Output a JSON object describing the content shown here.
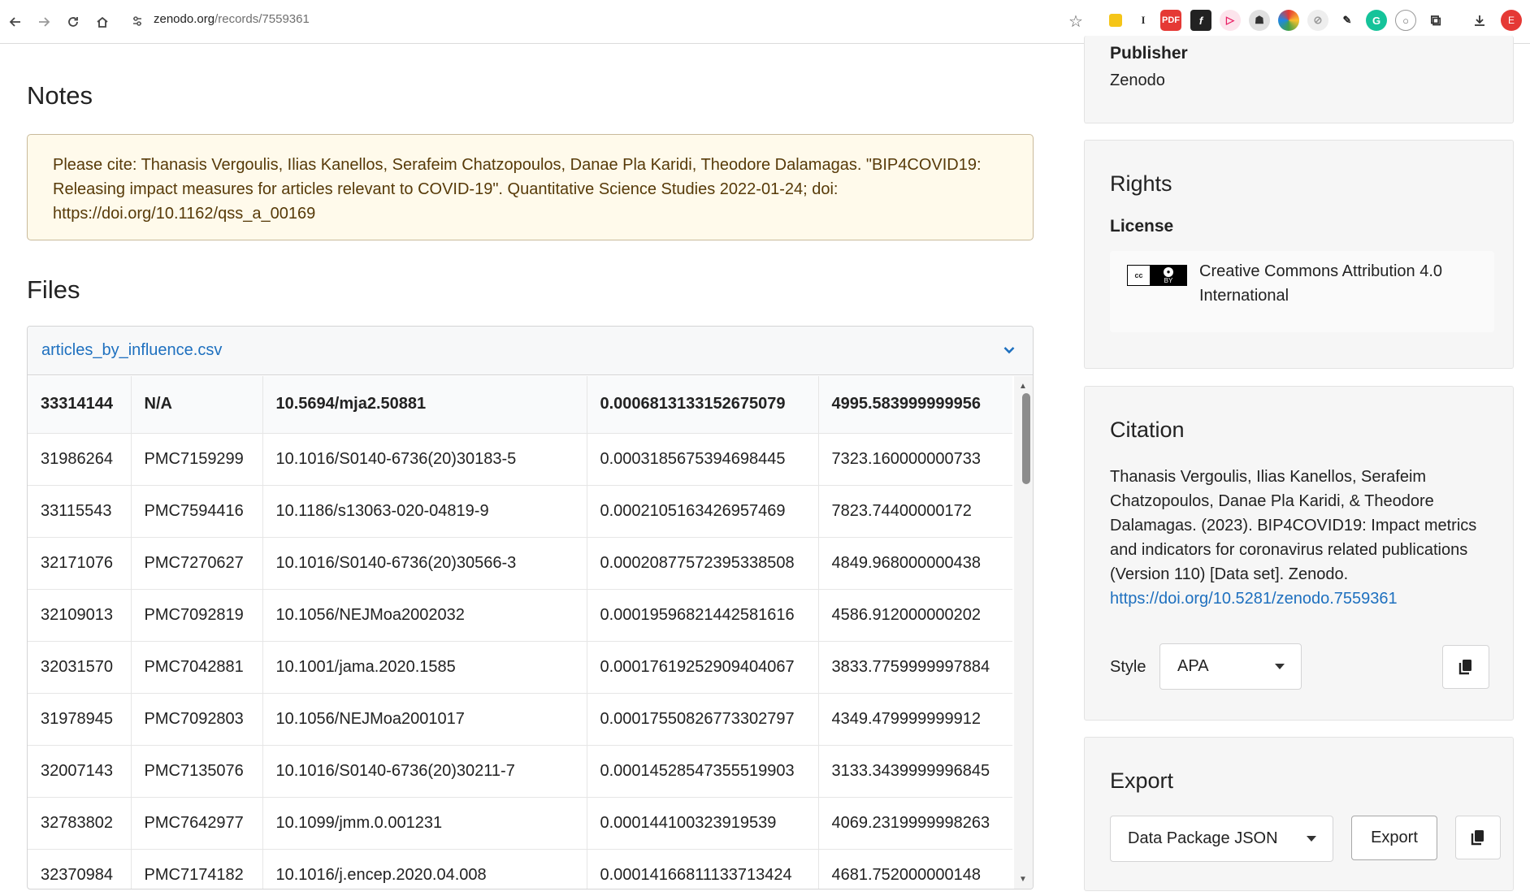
{
  "browser": {
    "url_domain": "zenodo.org",
    "url_path": "/records/7559361",
    "profile_initial": "E",
    "extensions": [
      "yellow-note",
      "text-i",
      "pdf-red",
      "font-f",
      "arrow-pink",
      "robot",
      "color-wheel",
      "compass",
      "pen",
      "grammarly",
      "circle",
      "puzzle"
    ]
  },
  "notes": {
    "heading": "Notes",
    "text": "Please cite: Thanasis Vergoulis, Ilias Kanellos, Serafeim Chatzopoulos, Danae Pla Karidi, Theodore Dalamagas. \"BIP4COVID19: Releasing impact measures for articles relevant to COVID-19\". Quantitative Science Studies 2022-01-24; doi: https://doi.org/10.1162/qss_a_00169"
  },
  "files": {
    "heading": "Files",
    "file_name": "articles_by_influence.csv",
    "rows": [
      [
        "33314144",
        "N/A",
        "10.5694/mja2.50881",
        "0.0006813133152675079",
        "4995.583999999956"
      ],
      [
        "31986264",
        "PMC7159299",
        "10.1016/S0140-6736(20)30183-5",
        "0.0003185675394698445",
        "7323.160000000733"
      ],
      [
        "33115543",
        "PMC7594416",
        "10.1186/s13063-020-04819-9",
        "0.0002105163426957469",
        "7823.74400000172"
      ],
      [
        "32171076",
        "PMC7270627",
        "10.1016/S0140-6736(20)30566-3",
        "0.00020877572395338508",
        "4849.968000000438"
      ],
      [
        "32109013",
        "PMC7092819",
        "10.1056/NEJMoa2002032",
        "0.00019596821442581616",
        "4586.912000000202"
      ],
      [
        "32031570",
        "PMC7042881",
        "10.1001/jama.2020.1585",
        "0.00017619252909404067",
        "3833.7759999997884"
      ],
      [
        "31978945",
        "PMC7092803",
        "10.1056/NEJMoa2001017",
        "0.00017550826773302797",
        "4349.479999999912"
      ],
      [
        "32007143",
        "PMC7135076",
        "10.1016/S0140-6736(20)30211-7",
        "0.00014528547355519903",
        "3133.3439999996845"
      ],
      [
        "32783802",
        "PMC7642977",
        "10.1099/jmm.0.001231",
        "0.000144100323919539",
        "4069.2319999998263"
      ],
      [
        "32370984",
        "PMC7174182",
        "10.1016/j.encep.2020.04.008",
        "0.00014166811133713424",
        "4681.752000000148"
      ]
    ]
  },
  "publisher": {
    "label": "Publisher",
    "value": "Zenodo"
  },
  "rights": {
    "title": "Rights",
    "license_label": "License",
    "license_name": "Creative Commons Attribution 4.0 International",
    "badge_left": "cc",
    "badge_right": "BY"
  },
  "citation": {
    "title": "Citation",
    "text": "Thanasis Vergoulis, Ilias Kanellos, Serafeim Chatzopoulos, Danae Pla Karidi, & Theodore Dalamagas. (2023). BIP4COVID19: Impact metrics and indicators for coronavirus related publications (Version 110) [Data set]. Zenodo.",
    "link": "https://doi.org/10.5281/zenodo.7559361",
    "style_label": "Style",
    "style_value": "APA"
  },
  "export": {
    "title": "Export",
    "format_value": "Data Package JSON",
    "button_label": "Export"
  },
  "colors": {
    "link": "#1e70bf",
    "notes_bg": "#fffaeb",
    "notes_text": "#573a08",
    "card_bg": "#f6f6f6"
  }
}
